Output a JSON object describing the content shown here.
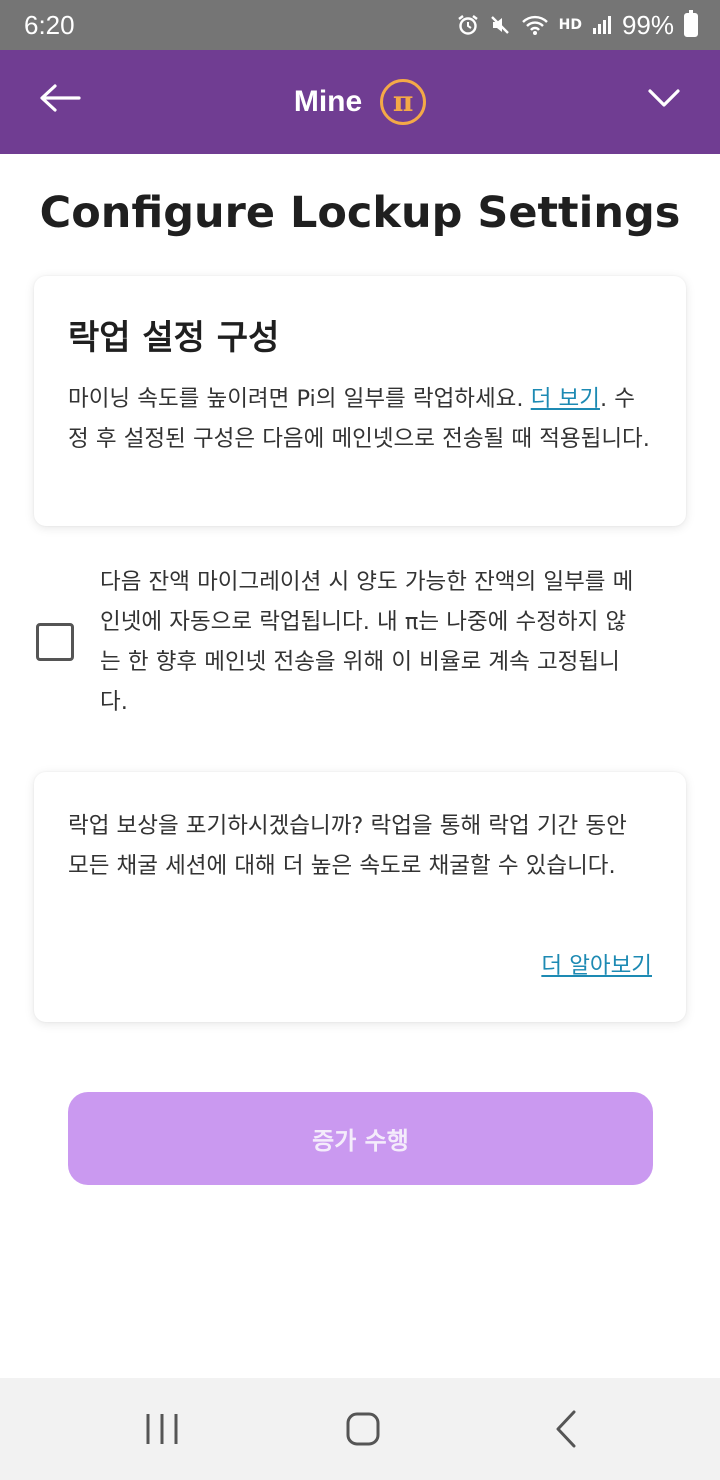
{
  "status_bar": {
    "time": "6:20",
    "battery": "99%",
    "network_label": "HD"
  },
  "app_bar": {
    "title": "Mine",
    "logo_glyph": "π"
  },
  "page_title": "Configure Lockup Settings",
  "info_card": {
    "heading": "락업 설정 구성",
    "body_before_link": "마이닝 속도를 높이려면 Pi의 일부를 락업하세요. ",
    "link_text": "더 보기",
    "body_after_link": ". 수정 후 설정된 구성은 다음에 메인넷으로 전송될 때 적용됩니다."
  },
  "auto_lockup": {
    "checked": false,
    "text": "다음 잔액 마이그레이션 시 양도 가능한 잔액의 일부를 메인넷에 자동으로 락업됩니다. 내 π는 나중에 수정하지 않는 한 향후 메인넷 전송을 위해 이 비율로 계속 고정됩니다."
  },
  "forfeit_card": {
    "body": "락업 보상을 포기하시겠습니까? 락업을 통해 락업 기간 동안 모든 채굴 세션에 대해 더 높은 속도로 채굴할 수 있습니다.",
    "learn_more": "더 알아보기"
  },
  "primary_button": {
    "label": "증가 수행",
    "enabled": false
  },
  "colors": {
    "app_bar": "#703d92",
    "pi_gold": "#f4a947",
    "button_disabled": "#ca99f0",
    "link": "#1d8ab3",
    "status_bar": "#757575"
  },
  "icons": {
    "back": "arrow-left-icon",
    "dropdown": "chevron-down-icon",
    "nav_recents": "recents-icon",
    "nav_home": "home-icon",
    "nav_back": "back-chevron-icon"
  }
}
